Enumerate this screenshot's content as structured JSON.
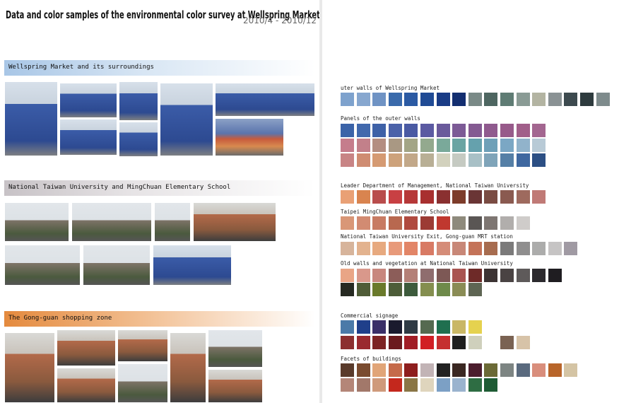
{
  "header": {
    "title": "Data and color samples of the environmental color survey at Wellspring Market",
    "date": "2010/4 - 2010/12"
  },
  "sections": {
    "s1": "Wellspring Market and its surroundings",
    "s2": "National Taiwan University and MingChuan Elementary School",
    "s3": "The Gong-guan shopping zone"
  },
  "palettes": [
    {
      "label": "uter walls of Wellspring Market",
      "rows": [
        [
          "#7ea2cd",
          "#87a7cf",
          "#6f93c4",
          "#3a6aab",
          "#2b5aa3",
          "#204b95",
          "#1a3c86",
          "#132e70",
          "#7a8a87",
          "#4e6661",
          "#5f7c74",
          "#8a9b95",
          "#b3b4a2",
          "#8a9294",
          "#3d4a4f",
          "#2e3b3e",
          "#7e8b8c"
        ]
      ]
    },
    {
      "label": "Panels of the outer walls",
      "rows": [
        [
          "#3b63a8",
          "#4269ad",
          "#3e61a7",
          "#4b62a9",
          "#4a5aa3",
          "#5b5aa2",
          "#6a5a9b",
          "#7c5a96",
          "#845a92",
          "#8f5a8e",
          "#975a8a",
          "#a15f8a",
          "#a36690",
          "#ffffff"
        ],
        [
          "#c57d8c",
          "#c2808a",
          "#b48e81",
          "#a99883",
          "#a3a586",
          "#93a98e",
          "#7aa99a",
          "#6aa4a3",
          "#65a1ad",
          "#6ea0b8",
          "#7ba7c4",
          "#91b3cb",
          "#b8cad6"
        ],
        [
          "#c88485",
          "#cf8c72",
          "#d59a72",
          "#cda27b",
          "#c2a889",
          "#b8af95",
          "#d2d1bd",
          "#c5cac2",
          "#a8c0c6",
          "#7fa4b9",
          "#557fa6",
          "#3f68a0",
          "#2c4f84"
        ]
      ]
    },
    {
      "label": "Leader Department of Management, National Taiwan University",
      "rows": [
        [
          "#e9a075",
          "#d9844f",
          "#b94d4c",
          "#c84043",
          "#b63838",
          "#a8302f",
          "#8a3030",
          "#7d3c2a",
          "#6a3535",
          "#7a4c43",
          "#8a5a50",
          "#9e6a5e",
          "#c07a76",
          "#ffffff"
        ]
      ]
    },
    {
      "label": "Taipei MingChuan Elementary School",
      "rows": [
        [
          "#d99777",
          "#d28b72",
          "#c87b63",
          "#b8684f",
          "#b04a3f",
          "#9c3b34",
          "#c0382f",
          "#8e8a7c",
          "#5a5654",
          "#7e7672",
          "#b1aeac",
          "#cfccca"
        ]
      ]
    },
    {
      "label": "National Taiwan University Exit, Gong-guan MRT station",
      "rows": [
        [
          "#d7b49b",
          "#e3b38f",
          "#e7a97f",
          "#e89a7a",
          "#e28567",
          "#d87a64",
          "#d58c78",
          "#c88777",
          "#c47358",
          "#a76c4f",
          "#7b7a7a",
          "#8f8e8e",
          "#acacab",
          "#c6c4c4",
          "#a09aa3"
        ]
      ]
    },
    {
      "label": "Old walls and vegetation at National Taiwan University",
      "rows": [
        [
          "#e9a586",
          "#d9988b",
          "#c8877e",
          "#8c5d59",
          "#b48077",
          "#8f6d6e",
          "#7d5855",
          "#a95450",
          "#6e2a28",
          "#3c3434",
          "#4a4343",
          "#5e5a5a",
          "#2c2a2e",
          "#1f1d21"
        ],
        [
          "#262a22",
          "#4f5c37",
          "#6a7a2b",
          "#4d5d39",
          "#3d5b3c",
          "#848e4f",
          "#6e8a4a",
          "#8a8c55",
          "#5e6553"
        ]
      ]
    },
    {
      "label": "Commercial signage",
      "rows": [
        [
          "#4b7aa8",
          "#1f3f8a",
          "#3a2f68",
          "#1a1a2e",
          "#2f3a45",
          "#556a50",
          "#1f6f4f",
          "#c9b765",
          "#e5d24f"
        ],
        [
          "#8c2f2f",
          "#9a2a2f",
          "#7d2424",
          "#6b1a1e",
          "#a11d26",
          "#d11f24",
          "#c52f2f",
          "#1f1f1f",
          "#cfd0bc",
          "#ffffff",
          "#7a6252",
          "#d7c3a8"
        ]
      ]
    },
    {
      "label": "Facets of buildings",
      "rows": [
        [
          "#5a3b2b",
          "#7a4b2f",
          "#e1a578",
          "#c56a4a",
          "#8e1e1e",
          "#c2b4b6",
          "#222",
          "#3a2722",
          "#4c1e2e",
          "#6b6a36",
          "#7d8583",
          "#5a6a7e",
          "#d98e7c",
          "#b8652a",
          "#d4c4a4"
        ],
        [
          "#b48678",
          "#a2786a",
          "#cf9a7b",
          "#c4281d",
          "#8a7646",
          "#dfd5bd",
          "#7ca0c5",
          "#9ab3ce",
          "#2e6d43",
          "#1e5c34"
        ]
      ]
    }
  ]
}
